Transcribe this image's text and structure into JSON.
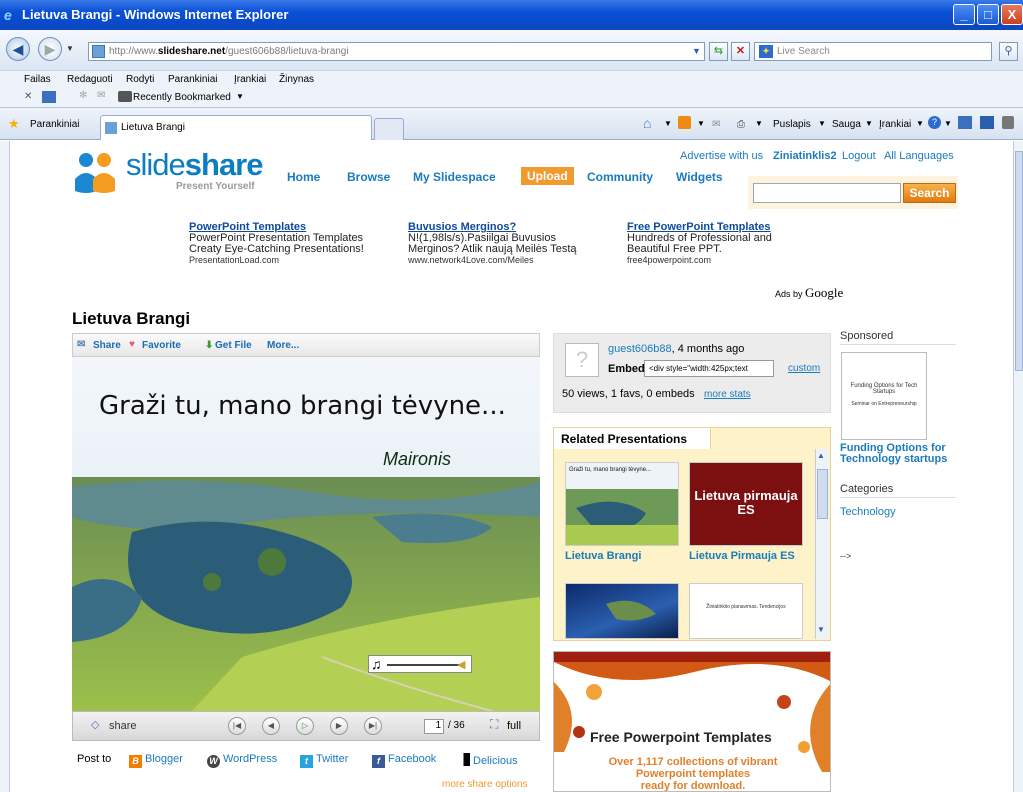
{
  "window": {
    "title": "Lietuva Brangi - Windows Internet Explorer"
  },
  "address": {
    "url_prefix": "http://www.",
    "url_domain": "slideshare.net",
    "url_path": "/guest606b88/lietuva-brangi"
  },
  "live_search": {
    "placeholder": "Live Search"
  },
  "menu": [
    "Failas",
    "Redaguoti",
    "Rodyti",
    "Parankiniai",
    "Įrankiai",
    "Žinynas"
  ],
  "bookmarks": {
    "recently": "Recently Bookmarked"
  },
  "favorites": {
    "label": "Parankiniai"
  },
  "tab": {
    "title": "Lietuva Brangi"
  },
  "command_bar": {
    "page": "Puslapis",
    "safety": "Sauga",
    "tools": "Įrankiai"
  },
  "site": {
    "logo_light": "slide",
    "logo_bold": "share",
    "tagline": "Present Yourself",
    "nav": [
      "Home",
      "Browse",
      "My Slidespace",
      "Upload",
      "Community",
      "Widgets"
    ],
    "toplinks": {
      "advertise": "Advertise with us",
      "user": "Ziniatinklis2",
      "logout": "Logout",
      "languages": "All Languages"
    },
    "search_button": "Search"
  },
  "ads": [
    {
      "title": "PowerPoint Templates",
      "line1": "PowerPoint Presentation Templates",
      "line2": "Creaty Eye-Catching Presentations!",
      "url": "PresentationLoad.com"
    },
    {
      "title": "Buvusios Merginos?",
      "line1": "N!(1,98ls/s).Pasiilgai Buvusios",
      "line2": "Merginos? Atlik naują Meilės Testą",
      "url": "www.network4Love.com/Meiles"
    },
    {
      "title": "Free PowerPoint Templates",
      "line1": "Hundreds of Professional and",
      "line2": "Beautiful Free PPT.",
      "url": "free4powerpoint.com"
    }
  ],
  "ads_by": {
    "prefix": "Ads by",
    "brand": "Google"
  },
  "presentation": {
    "title": "Lietuva Brangi",
    "share_actions": [
      "Share",
      "Favorite",
      "Get File",
      "More..."
    ],
    "slide_title": "Graži tu, mano brangi tėvyne...",
    "slide_author": "Maironis",
    "player": {
      "share": "share",
      "page": "1",
      "total": "/ 36",
      "full": "full"
    }
  },
  "post_to": {
    "label": "Post to",
    "services": [
      "Blogger",
      "WordPress",
      "Twitter",
      "Facebook",
      "Delicious"
    ],
    "more": "more share options"
  },
  "info": {
    "user": "guest606b88",
    "age": ", 4 months ago",
    "embed_label": "Embed",
    "embed_code": "<div style=\"width:425px;text",
    "custom": "custom",
    "stats": "50 views, 1 favs, 0 embeds",
    "more_stats": "more stats"
  },
  "related": {
    "heading": "Related Presentations",
    "items": [
      {
        "title": "Lietuva Brangi",
        "thumb_text": "Graži tu, mano brangi tėvyne..."
      },
      {
        "title": "Lietuva Pirmauja ES",
        "thumb_text": "Lietuva pirmauja ES"
      },
      {
        "title": "",
        "thumb_text": ""
      },
      {
        "title": "",
        "thumb_text": "Žiniatinklio planavimas. Tendencijos"
      }
    ]
  },
  "ppt_ad": {
    "title": "Free Powerpoint Templates",
    "line1": "Over 1,117 collections of vibrant",
    "line2": "Powerpoint templates",
    "line3": "ready for download."
  },
  "sidebar": {
    "sponsored": "Sponsored",
    "sponsor_thumb_title": "Funding Options for Tech Startups",
    "sponsor_thumb_sub": "Seminar on Entrepreneurship",
    "sponsor_link": "Funding Options for Technology startups",
    "categories": "Categories",
    "category": "Technology",
    "arrow": "-->"
  }
}
